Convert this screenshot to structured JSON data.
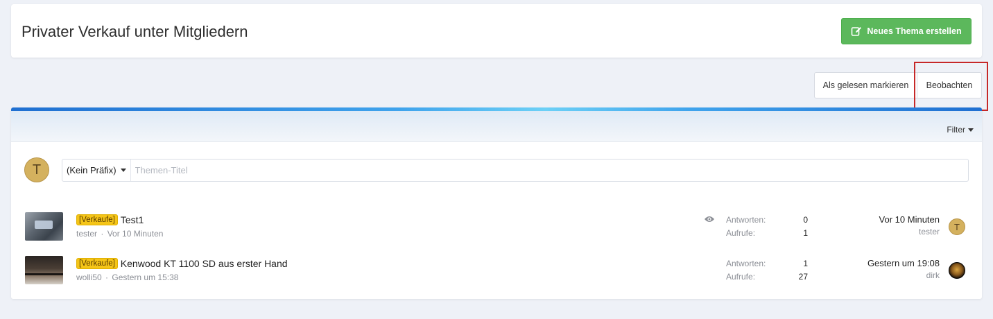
{
  "header": {
    "title": "Privater Verkauf unter Mitgliedern",
    "new_thread_label": "Neues Thema erstellen"
  },
  "actions": {
    "mark_read_label": "Als gelesen markieren",
    "watch_label": "Beobachten"
  },
  "filter": {
    "label": "Filter"
  },
  "quick_post": {
    "avatar_letter": "T",
    "prefix_selected": "(Kein Präfix)",
    "title_placeholder": "Themen-Titel"
  },
  "threads": [
    {
      "prefix": "[Verkaufe]",
      "title": "Test1",
      "author": "tester",
      "separator": "·",
      "started": "Vor 10 Minuten",
      "replies_label": "Antworten:",
      "replies": "0",
      "views_label": "Aufrufe:",
      "views": "1",
      "last_time": "Vor 10 Minuten",
      "last_user": "tester",
      "last_avatar_letter": "T",
      "watched": true
    },
    {
      "prefix": "[Verkaufe]",
      "title": "Kenwood KT 1100 SD aus erster Hand",
      "author": "wolli50",
      "separator": "·",
      "started": "Gestern um 15:38",
      "replies_label": "Antworten:",
      "replies": "1",
      "views_label": "Aufrufe:",
      "views": "27",
      "last_time": "Gestern um 19:08",
      "last_user": "dirk",
      "watched": false
    }
  ],
  "colors": {
    "primary_button": "#5cb85c",
    "prefix_badge": "#f5c518",
    "highlight_box": "#c62828",
    "topbar_accent": "#3fa3ec"
  }
}
